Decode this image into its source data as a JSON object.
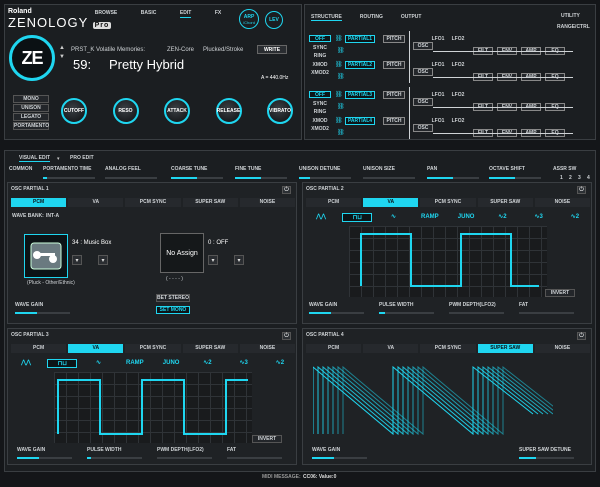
{
  "brand": {
    "maker": "Roland",
    "product": "ZENOLOGY",
    "edition": "Pro",
    "logo": "ZE"
  },
  "top_tabs": [
    "BROWSE",
    "BASIC",
    "EDIT",
    "FX"
  ],
  "top_buttons": {
    "arp": "ARP",
    "arp_sub": "/Chord",
    "lev": "LEV"
  },
  "patch": {
    "bank": "PRST_K Volatile Memories:",
    "engine": "ZEN-Core",
    "category": "Plucked/Stroke",
    "number": "59:",
    "name": "Pretty Hybrid",
    "tuning": "A = 440.0Hz",
    "write": "WRITE"
  },
  "modes": [
    "MONO",
    "UNISON",
    "LEGATO",
    "PORTAMENTO"
  ],
  "knobs": [
    "CUTOFF",
    "RESO",
    "ATTACK",
    "RELEASE",
    "VIBRATO"
  ],
  "struct_tabs": [
    "STRUCTURE",
    "ROUTING",
    "OUTPUT"
  ],
  "utility": [
    "UTILITY",
    "RANGE/CTRL"
  ],
  "struct": {
    "modes": [
      "OFF",
      "SYNC",
      "RING",
      "XMOD",
      "XMOD2"
    ],
    "partials": [
      "PARTIAL1",
      "PARTIAL2",
      "PARTIAL3",
      "PARTIAL4"
    ],
    "blocks": [
      "PITCH",
      "OSC",
      "LFO1",
      "LFO2",
      "FILT",
      "ENV",
      "AMP",
      "EQ"
    ]
  },
  "edit_tabs": [
    "VISUAL EDIT",
    "PRO EDIT"
  ],
  "common": {
    "labels": [
      "COMMON",
      "PORTAMENTO TIME",
      "ANALOG FEEL",
      "COARSE TUNE",
      "FINE TUNE",
      "UNISON DETUNE",
      "UNISON SIZE",
      "PAN",
      "OCTAVE SHIFT",
      "ASSR SW"
    ],
    "assr": [
      "1",
      "2",
      "3",
      "4"
    ]
  },
  "osc_types": [
    "PCM",
    "VA",
    "PCM SYNC",
    "SUPER SAW",
    "NOISE"
  ],
  "waves": [
    "RAMP",
    "JUNO"
  ],
  "p1": {
    "title": "OSC PARTIAL 1",
    "wave_bank": "WAVE BANK:",
    "bank": "INT-A",
    "wave": "34 : Music Box",
    "assign": "No Assign",
    "assign_value": "0 : OFF",
    "dashes": "( - - - - )",
    "category": "(Pluck - Other/Ethnic)",
    "bet_stereo": "BET STEREO",
    "set_mono": "SET MONO",
    "gain": "WAVE GAIN"
  },
  "p2": {
    "title": "OSC PARTIAL 2",
    "invert": "INVERT",
    "labels": [
      "WAVE GAIN",
      "PULSE WIDTH",
      "PWM DEPTH(LFO2)",
      "FAT"
    ]
  },
  "p3": {
    "title": "OSC PARTIAL 3",
    "invert": "INVERT",
    "labels": [
      "WAVE GAIN",
      "PULSE WIDTH",
      "PWM DEPTH(LFO2)",
      "FAT"
    ]
  },
  "p4": {
    "title": "OSC PARTIAL 4",
    "labels": [
      "WAVE GAIN",
      "SUPER SAW DETUNE"
    ]
  },
  "status": {
    "label": "MIDI MESSAGE:",
    "value": "CC06: Value:0"
  },
  "colors": {
    "accent": "#1fd6f0",
    "bg": "#141619"
  }
}
